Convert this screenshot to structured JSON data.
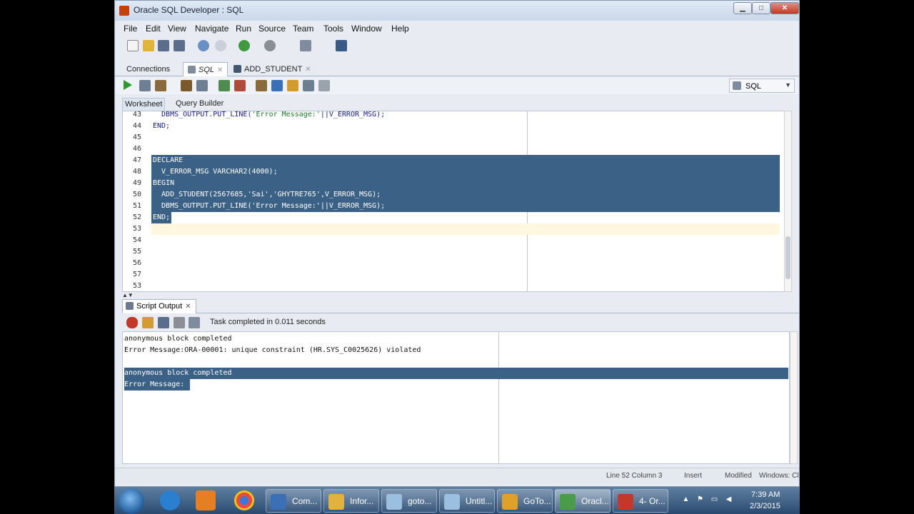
{
  "window": {
    "title": "Oracle SQL Developer : SQL",
    "controls": {
      "minimize": "▁",
      "maximize": "□",
      "close": "✕"
    }
  },
  "menu": [
    "File",
    "Edit",
    "View",
    "Navigate",
    "Run",
    "Source",
    "Team",
    "Tools",
    "Window",
    "Help"
  ],
  "editor_tabs": [
    {
      "label": "Connections",
      "active": false,
      "icon": ""
    },
    {
      "label": "SQL",
      "active": true,
      "icon": "sql-worksheet-icon"
    },
    {
      "label": "ADD_STUDENT",
      "active": false,
      "icon": "procedure-icon"
    }
  ],
  "connection": {
    "selected": "SQL"
  },
  "worksheet_tabs": [
    "Worksheet",
    "Query Builder"
  ],
  "code_lines": [
    {
      "num": "43",
      "text": "  DBMS_OUTPUT.PUT_LINE('Error Message:'||V_ERROR_MSG);",
      "selected": false
    },
    {
      "num": "44",
      "text": "END;",
      "selected": false
    },
    {
      "num": "45",
      "text": "",
      "selected": false
    },
    {
      "num": "46",
      "text": "",
      "selected": false
    },
    {
      "num": "47",
      "text": "DECLARE",
      "selected": true
    },
    {
      "num": "48",
      "text": "  V_ERROR_MSG VARCHAR2(4000);",
      "selected": true
    },
    {
      "num": "49",
      "text": "BEGIN",
      "selected": true
    },
    {
      "num": "50",
      "text": "  ADD_STUDENT(2567685,'Sai','GHYTRE765',V_ERROR_MSG);",
      "selected": true
    },
    {
      "num": "51",
      "text": "  DBMS_OUTPUT.PUT_LINE('Error Message:'||V_ERROR_MSG);",
      "selected": true
    },
    {
      "num": "52",
      "text": "END;",
      "selected": true
    },
    {
      "num": "53",
      "text": "",
      "selected": false
    },
    {
      "num": "54",
      "text": "",
      "selected": false
    },
    {
      "num": "55",
      "text": "",
      "selected": false
    },
    {
      "num": "56",
      "text": "",
      "selected": false
    },
    {
      "num": "57",
      "text": "",
      "selected": false
    },
    {
      "num": "53",
      "text": "",
      "selected": false
    }
  ],
  "output": {
    "tab_label": "Script Output",
    "status": "Task completed in 0.011 seconds",
    "lines": [
      {
        "text": "anonymous block completed",
        "selected": false
      },
      {
        "text": "Error Message:ORA-00001: unique constraint (HR.SYS_C0025626) violated",
        "selected": false
      },
      {
        "text": "",
        "selected": false
      },
      {
        "text": "anonymous block completed",
        "selected": true
      },
      {
        "text": "Error Message:",
        "selected": true
      }
    ]
  },
  "statusbar": {
    "position": "Line 52 Column 3",
    "mode": "Insert",
    "modified": "Modified",
    "platform": "Windows: Cl"
  },
  "taskbar": {
    "tasks": [
      {
        "label": "Com...",
        "color": "#3b6fb6",
        "active": false
      },
      {
        "label": "Infor...",
        "color": "#e2b33c",
        "active": false
      },
      {
        "label": "goto...",
        "color": "#9bc0df",
        "active": false
      },
      {
        "label": "Untitl...",
        "color": "#9bc0df",
        "active": false
      },
      {
        "label": "GoTo...",
        "color": "#e0a12a",
        "active": false
      },
      {
        "label": "Oracl...",
        "color": "#4a9b4a",
        "active": true
      },
      {
        "label": "4- Or...",
        "color": "#c0392b",
        "active": false
      }
    ],
    "time": "7:39 AM",
    "date": "2/3/2015"
  },
  "colors": {
    "selection": "#3c6186",
    "string_literal": "#1b7a2a",
    "keyword": "#1a1a8c"
  }
}
